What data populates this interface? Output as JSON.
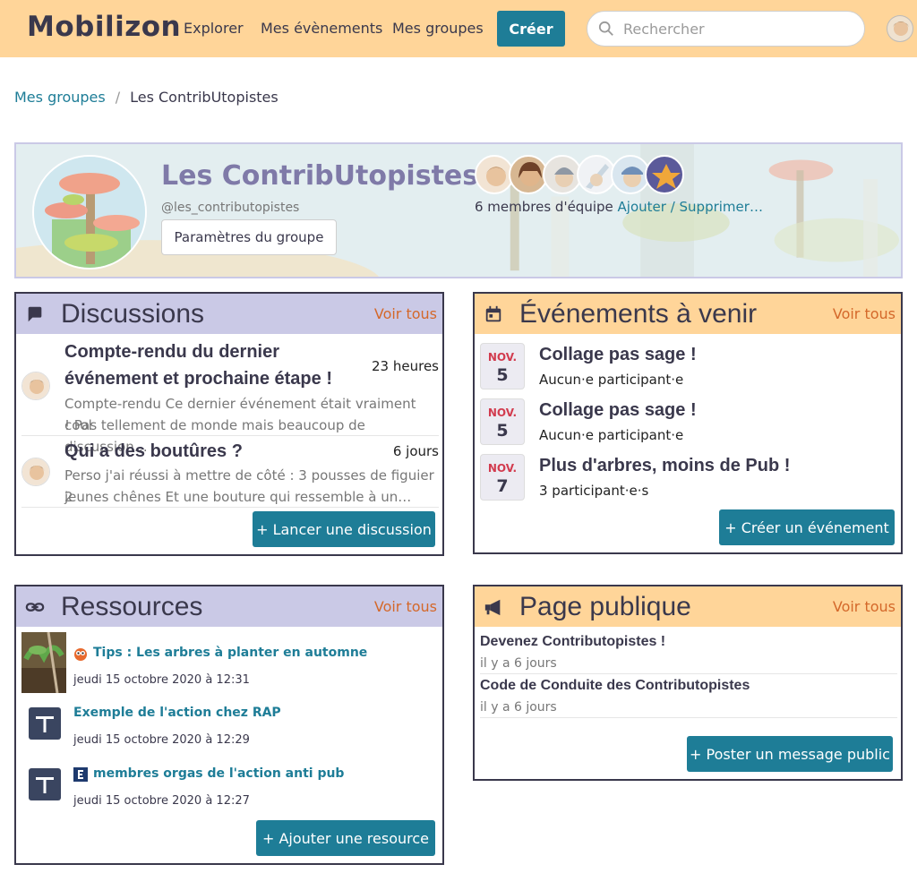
{
  "nav": {
    "logo": "Mobilizon",
    "links": [
      "Explorer",
      "Mes évènements",
      "Mes groupes"
    ],
    "create_label": "Créer",
    "search_placeholder": "Rechercher"
  },
  "breadcrumb": {
    "parent": "Mes groupes",
    "current": "Les ContribUtopistes"
  },
  "group": {
    "name": "Les ContribUtopistes",
    "handle": "@les_contributopistes",
    "settings_label": "Paramètres du groupe",
    "members_text": "6 membres d'équipe",
    "members_action": "Ajouter / Supprimer…",
    "member_colors": [
      "#d8b08e",
      "#8a5a3c",
      "#9aa7b5",
      "#c9d6e0",
      "#6f8fb8",
      "#e0a23c"
    ]
  },
  "discussions": {
    "title": "Discussions",
    "see_all": "Voir tous",
    "items": [
      {
        "title": "Compte-rendu du dernier événement et prochaine étape !",
        "title_l1": "Compte-rendu du dernier",
        "title_l2": "événement et prochaine étape !",
        "time": "23 heures",
        "excerpt_l1": "Compte-rendu Ce dernier événement était vraiment cool",
        "excerpt_l2": "! Pas tellement de monde mais beaucoup de discussion…"
      },
      {
        "title": "Qui a des boutûres ?",
        "time": "6 jours",
        "excerpt_l1": "Perso j'ai réussi à mettre de côté : 3 pousses de figuier 2",
        "excerpt_l2": "jeunes chênes Et une bouture qui ressemble à un…"
      }
    ],
    "button": "+ Lancer une discussion"
  },
  "events": {
    "title": "Événements à venir",
    "see_all": "Voir tous",
    "items": [
      {
        "month": "NOV.",
        "day": "5",
        "title": "Collage pas sage !",
        "participants": "Aucun·e participant·e"
      },
      {
        "month": "NOV.",
        "day": "5",
        "title": "Collage pas sage !",
        "participants": "Aucun·e participant·e"
      },
      {
        "month": "NOV.",
        "day": "7",
        "title": "Plus d'arbres, moins de Pub !",
        "participants": "3 participant·e·s"
      }
    ],
    "button": "+ Créer un événement"
  },
  "resources": {
    "title": "Ressources",
    "see_all": "Voir tous",
    "items": [
      {
        "title": "Tips : Les arbres à planter en automne",
        "date": "jeudi 15 octobre 2020 à 12:31",
        "icon": "owl-icon"
      },
      {
        "title": "Exemple de l'action chez RAP",
        "date": "jeudi 15 octobre 2020 à 12:29",
        "icon": "document-icon"
      },
      {
        "title": "membres orgas de l'action anti pub",
        "date": "jeudi 15 octobre 2020 à 12:27",
        "icon": "document-icon"
      }
    ],
    "button": "+ Ajouter une resource"
  },
  "public_page": {
    "title": "Page publique",
    "see_all": "Voir tous",
    "items": [
      {
        "title": "Devenez Contributopistes !",
        "date": "il y a 6 jours"
      },
      {
        "title": "Code de Conduite des Contributopistes",
        "date": "il y a 6 jours"
      }
    ],
    "button": "+ Poster un message public"
  },
  "colors": {
    "nav_bg": "#ffd599",
    "primary": "#1e7d97",
    "violet_head": "#cac9e6",
    "orange_head": "#ffd599",
    "accent_orange": "#d4682a",
    "text": "#3a384c"
  }
}
